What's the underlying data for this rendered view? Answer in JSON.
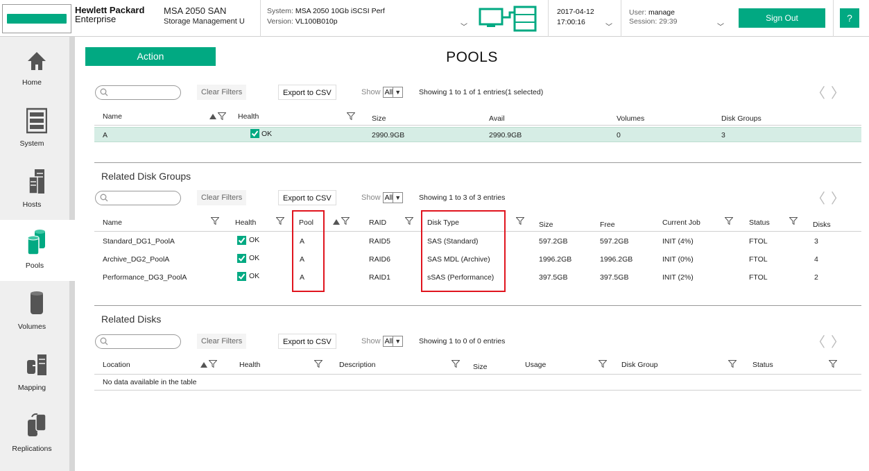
{
  "header": {
    "brand_line1": "Hewlett Packard",
    "brand_line2": "Enterprise",
    "product_name": "MSA 2050 SAN",
    "product_sub": "Storage Management U",
    "system_label": "System:",
    "system_value": "MSA 2050 10Gb iSCSI Perf",
    "version_label": "Version:",
    "version_value": "VL100B010p",
    "date": "2017-04-12",
    "time": "17:00:16",
    "user_label": "User:",
    "user_value": "manage",
    "session_label": "Session:",
    "session_value": "29:39",
    "signout_label": "Sign Out",
    "help_label": "?"
  },
  "sidebar": {
    "items": [
      {
        "label": "Home",
        "icon": "home-icon"
      },
      {
        "label": "System",
        "icon": "system-icon"
      },
      {
        "label": "Hosts",
        "icon": "hosts-icon"
      },
      {
        "label": "Pools",
        "icon": "pools-icon",
        "active": true
      },
      {
        "label": "Volumes",
        "icon": "volumes-icon"
      },
      {
        "label": "Mapping",
        "icon": "mapping-icon"
      },
      {
        "label": "Replications",
        "icon": "replications-icon"
      }
    ]
  },
  "main": {
    "action_label": "Action",
    "title": "POOLS",
    "clear_filters": "Clear Filters",
    "export_csv": "Export to CSV",
    "show_label": "Show",
    "show_value": "All",
    "pools": {
      "showing": "Showing 1 to 1 of 1 entries(1 selected)",
      "columns": [
        "Name",
        "Health",
        "Size",
        "Avail",
        "Volumes",
        "Disk Groups"
      ],
      "rows": [
        {
          "name": "A",
          "health": "OK",
          "size": "2990.9GB",
          "avail": "2990.9GB",
          "volumes": "0",
          "disk_groups": "3"
        }
      ]
    },
    "disk_groups": {
      "title": "Related Disk Groups",
      "showing": "Showing 1 to 3 of 3 entries",
      "columns": [
        "Name",
        "Health",
        "Pool",
        "RAID",
        "Disk Type",
        "Size",
        "Free",
        "Current Job",
        "Status",
        "Disks"
      ],
      "rows": [
        {
          "name": "Standard_DG1_PoolA",
          "health": "OK",
          "pool": "A",
          "raid": "RAID5",
          "disk_type": "SAS (Standard)",
          "size": "597.2GB",
          "free": "597.2GB",
          "job": "INIT (4%)",
          "status": "FTOL",
          "disks": "3"
        },
        {
          "name": "Archive_DG2_PoolA",
          "health": "OK",
          "pool": "A",
          "raid": "RAID6",
          "disk_type": "SAS MDL (Archive)",
          "size": "1996.2GB",
          "free": "1996.2GB",
          "job": "INIT (0%)",
          "status": "FTOL",
          "disks": "4"
        },
        {
          "name": "Performance_DG3_PoolA",
          "health": "OK",
          "pool": "A",
          "raid": "RAID1",
          "disk_type": "sSAS (Performance)",
          "size": "397.5GB",
          "free": "397.5GB",
          "job": "INIT (2%)",
          "status": "FTOL",
          "disks": "2"
        }
      ]
    },
    "disks": {
      "title": "Related Disks",
      "showing": "Showing 1 to 0 of 0 entries",
      "columns": [
        "Location",
        "Health",
        "Description",
        "Size",
        "Usage",
        "Disk Group",
        "Status"
      ],
      "empty": "No data available in the table"
    }
  },
  "colors": {
    "accent": "#01a982",
    "highlight": "#e0141e",
    "selected_row": "#d6ede5"
  }
}
